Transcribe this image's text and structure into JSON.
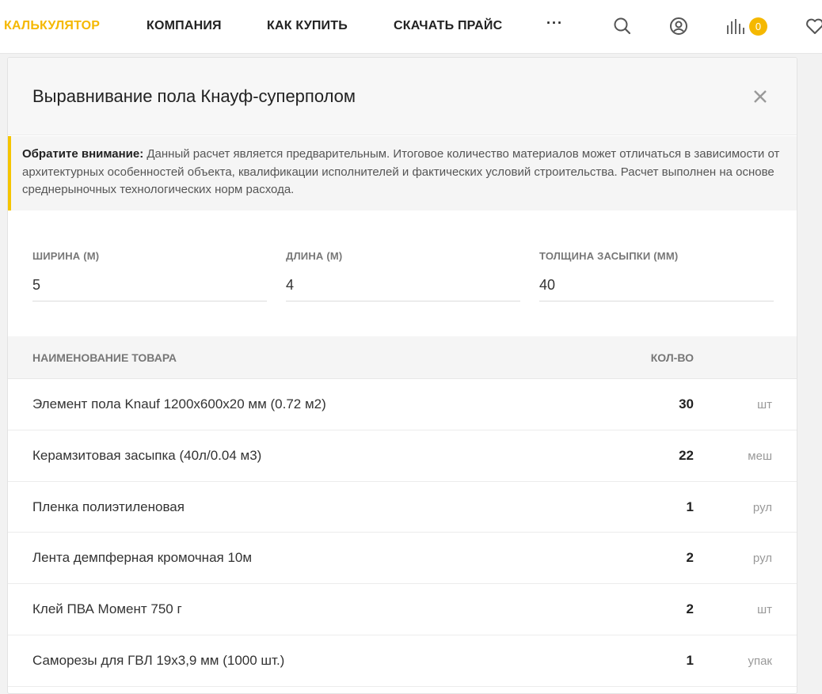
{
  "nav": {
    "items": [
      {
        "label": "КАЛЬКУЛЯТОР"
      },
      {
        "label": "КОМПАНИЯ"
      },
      {
        "label": "КАК КУПИТЬ"
      },
      {
        "label": "СКАЧАТЬ ПРАЙС"
      }
    ],
    "more": "···",
    "compare_count": "0",
    "icons": [
      "search-icon",
      "user-icon",
      "compare-icon",
      "heart-icon"
    ],
    "accent_color": "#f5b800"
  },
  "modal": {
    "title": "Выравнивание пола Кнауф-суперполом",
    "notice": {
      "bold": "Обратите внимание:",
      "text": " Данный расчет является предварительным. Итоговое количество материалов может отличаться в зависимости от архитектурных особенностей объекта, квалификации исполнителей и фактических условий строительства. Расчет выполнен на основе среднерыночных технологических норм расхода."
    },
    "fields": [
      {
        "label": "ШИРИНА (М)",
        "value": "5"
      },
      {
        "label": "ДЛИНА (М)",
        "value": "4"
      },
      {
        "label": "ТОЛЩИНА ЗАСЫПКИ (ММ)",
        "value": "40"
      }
    ],
    "table": {
      "headers": {
        "name": "НАИМЕНОВАНИЕ ТОВАРА",
        "qty": "КОЛ-ВО"
      },
      "rows": [
        {
          "name": "Элемент пола Knauf 1200x600x20 мм (0.72 м2)",
          "qty": "30",
          "unit": "шт"
        },
        {
          "name": "Керамзитовая засыпка (40л/0.04 м3)",
          "qty": "22",
          "unit": "меш"
        },
        {
          "name": "Пленка полиэтиленовая",
          "qty": "1",
          "unit": "рул"
        },
        {
          "name": "Лента демпферная кромочная 10м",
          "qty": "2",
          "unit": "рул"
        },
        {
          "name": "Клей ПВА Момент 750 г",
          "qty": "2",
          "unit": "шт"
        },
        {
          "name": "Саморезы для ГВЛ 19x3,9 мм (1000 шт.)",
          "qty": "1",
          "unit": "упак"
        }
      ]
    }
  }
}
